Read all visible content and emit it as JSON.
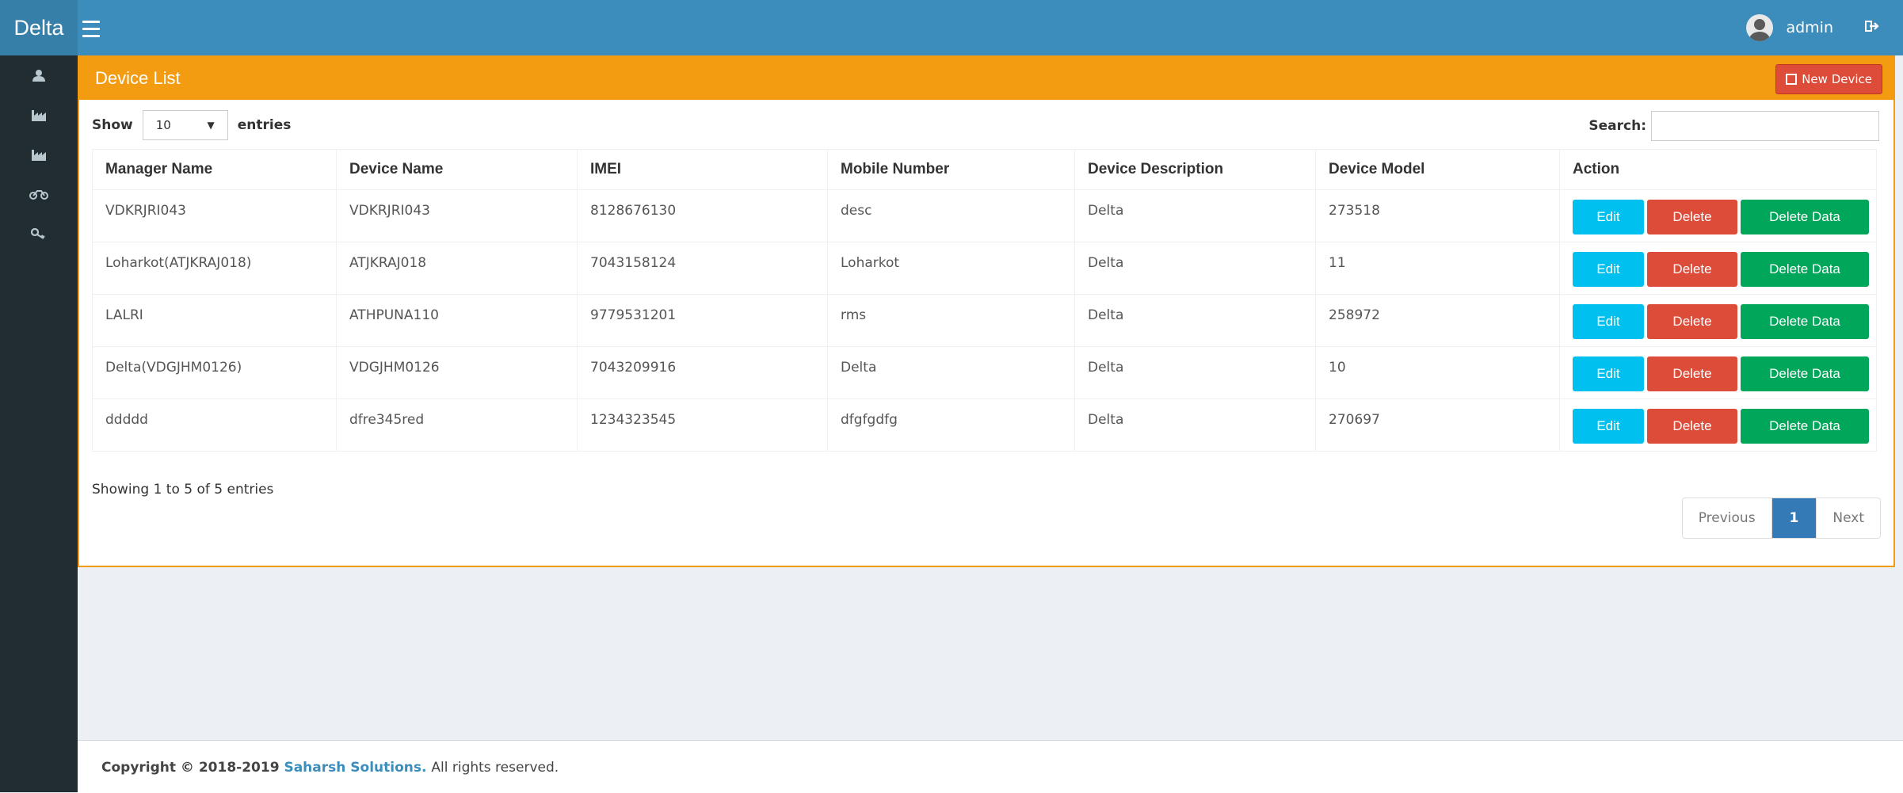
{
  "header": {
    "brand": "Delta",
    "username": "admin"
  },
  "sidebar": {
    "items": [
      {
        "icon": "user-icon"
      },
      {
        "icon": "factory-icon"
      },
      {
        "icon": "factory-icon"
      },
      {
        "icon": "motorcycle-icon"
      },
      {
        "icon": "key-icon"
      }
    ]
  },
  "box": {
    "title": "Device List",
    "new_button": "New Device"
  },
  "controls": {
    "show_label": "Show",
    "page_length": "10",
    "entries_label": "entries",
    "search_label": "Search:",
    "search_value": ""
  },
  "table": {
    "headers": [
      "Manager Name",
      "Device Name",
      "IMEI",
      "Mobile Number",
      "Device Description",
      "Device Model",
      "Action"
    ],
    "rows": [
      [
        "VDKRJRI043",
        "VDKRJRI043",
        "8128676130",
        "desc",
        "Delta",
        "273518"
      ],
      [
        "Loharkot(ATJKRAJ018)",
        "ATJKRAJ018",
        "7043158124",
        "Loharkot",
        "Delta",
        "11"
      ],
      [
        "LALRI",
        "ATHPUNA110",
        "9779531201",
        "rms",
        "Delta",
        "258972"
      ],
      [
        "Delta(VDGJHM0126)",
        "VDGJHM0126",
        "7043209916",
        "Delta",
        "Delta",
        "10"
      ],
      [
        "ddddd",
        "dfre345red",
        "1234323545",
        "dfgfgdfg",
        "Delta",
        "270697"
      ]
    ],
    "actions": {
      "edit": "Edit",
      "delete": "Delete",
      "delete_data": "Delete Data"
    }
  },
  "info": "Showing 1 to 5 of 5 entries",
  "pagination": {
    "previous": "Previous",
    "current": "1",
    "next": "Next"
  },
  "footer": {
    "copyright": "Copyright © 2018-2019",
    "company": "Saharsh Solutions.",
    "rest": "All rights reserved."
  },
  "colors": {
    "header": "#3c8dbc",
    "sidebar": "#222d32",
    "box_accent": "#f39c12",
    "edit": "#00c0ef",
    "delete": "#dd4b39",
    "delete_data": "#00a65a"
  }
}
